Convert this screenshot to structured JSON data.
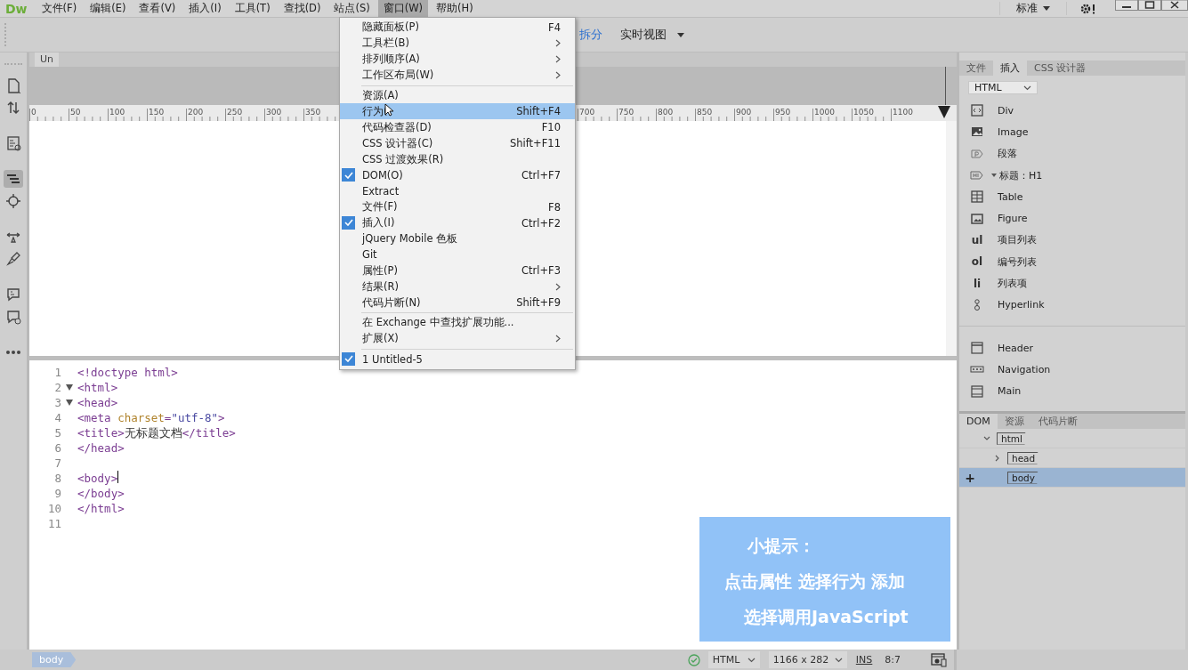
{
  "menubar": {
    "logo": "Dw",
    "menus": [
      {
        "label": "文件(F)",
        "selected": false
      },
      {
        "label": "编辑(E)",
        "selected": false
      },
      {
        "label": "查看(V)",
        "selected": false
      },
      {
        "label": "插入(I)",
        "selected": false
      },
      {
        "label": "工具(T)",
        "selected": false
      },
      {
        "label": "查找(D)",
        "selected": false
      },
      {
        "label": "站点(S)",
        "selected": false
      },
      {
        "label": "窗口(W)",
        "selected": true
      },
      {
        "label": "帮助(H)",
        "selected": false
      }
    ],
    "workspace": "标准"
  },
  "toolbar": {
    "views": [
      {
        "label": "拆分",
        "selected": true
      },
      {
        "label": "实时视图",
        "selected": false
      }
    ]
  },
  "document": {
    "tab": "Un",
    "ruler": {
      "left_labels": [
        "0",
        "50",
        "100",
        "150",
        "200",
        "250",
        "300",
        "350"
      ],
      "right_labels": [
        "700",
        "750",
        "800",
        "850",
        "900",
        "950",
        "1000",
        "1050",
        "1100"
      ]
    },
    "code_lines": [
      {
        "number": "1",
        "fold": false,
        "cursor": false,
        "tokens": [
          {
            "kind": "tag",
            "text": "<!doctype html>"
          }
        ]
      },
      {
        "number": "2",
        "fold": true,
        "cursor": false,
        "tokens": [
          {
            "kind": "tag",
            "text": "<html>"
          }
        ]
      },
      {
        "number": "3",
        "fold": true,
        "cursor": false,
        "tokens": [
          {
            "kind": "tag",
            "text": "<head>"
          }
        ]
      },
      {
        "number": "4",
        "fold": false,
        "cursor": false,
        "tokens": [
          {
            "kind": "tag",
            "text": "<meta "
          },
          {
            "kind": "attr",
            "text": "charset"
          },
          {
            "kind": "tag",
            "text": "="
          },
          {
            "kind": "string",
            "text": "\"utf-8\""
          },
          {
            "kind": "tag",
            "text": ">"
          }
        ]
      },
      {
        "number": "5",
        "fold": false,
        "cursor": false,
        "tokens": [
          {
            "kind": "tag",
            "text": "<title>"
          },
          {
            "kind": "text",
            "text": "无标题文档"
          },
          {
            "kind": "tag",
            "text": "</title>"
          }
        ]
      },
      {
        "number": "6",
        "fold": false,
        "cursor": false,
        "tokens": [
          {
            "kind": "tag",
            "text": "</head>"
          }
        ]
      },
      {
        "number": "7",
        "fold": false,
        "cursor": false
      },
      {
        "number": "8",
        "fold": false,
        "cursor": true,
        "tokens": [
          {
            "kind": "tag",
            "text": "<body>"
          }
        ]
      },
      {
        "number": "9",
        "fold": false,
        "cursor": false,
        "tokens": [
          {
            "kind": "tag",
            "text": "</body>"
          }
        ]
      },
      {
        "number": "10",
        "fold": false,
        "cursor": false,
        "tokens": [
          {
            "kind": "tag",
            "text": "</html>"
          }
        ]
      },
      {
        "number": "11",
        "fold": false,
        "cursor": false
      }
    ]
  },
  "window_menu": {
    "items": [
      {
        "kind": "item",
        "label": "隐藏面板(P)",
        "shortcut": "F4",
        "submenu": false,
        "checked": false,
        "selected": false
      },
      {
        "kind": "item",
        "label": "工具栏(B)",
        "submenu": true,
        "checked": false,
        "selected": false
      },
      {
        "kind": "item",
        "label": "排列顺序(A)",
        "submenu": true,
        "checked": false,
        "selected": false
      },
      {
        "kind": "item",
        "label": "工作区布局(W)",
        "submenu": true,
        "checked": false,
        "selected": false
      },
      {
        "kind": "separator"
      },
      {
        "kind": "item",
        "label": "资源(A)",
        "submenu": false,
        "checked": false,
        "selected": false
      },
      {
        "kind": "item",
        "label": "行为(",
        "shortcut": "Shift+F4",
        "submenu": false,
        "checked": false,
        "selected": true
      },
      {
        "kind": "item",
        "label": "代码检查器(D)",
        "shortcut": "F10",
        "submenu": false,
        "checked": false,
        "selected": false
      },
      {
        "kind": "item",
        "label": "CSS 设计器(C)",
        "shortcut": "Shift+F11",
        "submenu": false,
        "checked": false,
        "selected": false
      },
      {
        "kind": "item",
        "label": "CSS 过渡效果(R)",
        "submenu": false,
        "checked": false,
        "selected": false
      },
      {
        "kind": "item",
        "label": "DOM(O)",
        "shortcut": "Ctrl+F7",
        "submenu": false,
        "checked": true,
        "selected": false
      },
      {
        "kind": "item",
        "label": "Extract",
        "submenu": false,
        "checked": false,
        "selected": false
      },
      {
        "kind": "item",
        "label": "文件(F)",
        "shortcut": "F8",
        "submenu": false,
        "checked": false,
        "selected": false
      },
      {
        "kind": "item",
        "label": "插入(I)",
        "shortcut": "Ctrl+F2",
        "submenu": false,
        "checked": true,
        "selected": false
      },
      {
        "kind": "item",
        "label": "jQuery Mobile 色板",
        "submenu": false,
        "checked": false,
        "selected": false
      },
      {
        "kind": "item",
        "label": "Git",
        "submenu": false,
        "checked": false,
        "selected": false
      },
      {
        "kind": "item",
        "label": "属性(P)",
        "shortcut": "Ctrl+F3",
        "submenu": false,
        "checked": false,
        "selected": false
      },
      {
        "kind": "item",
        "label": "结果(R)",
        "submenu": true,
        "checked": false,
        "selected": false
      },
      {
        "kind": "item",
        "label": "代码片断(N)",
        "shortcut": "Shift+F9",
        "submenu": false,
        "checked": false,
        "selected": false
      },
      {
        "kind": "separator"
      },
      {
        "kind": "item",
        "label": "在 Exchange 中查找扩展功能...",
        "submenu": false,
        "checked": false,
        "selected": false
      },
      {
        "kind": "item",
        "label": "扩展(X)",
        "submenu": true,
        "checked": false,
        "selected": false
      },
      {
        "kind": "separator"
      },
      {
        "kind": "item",
        "label": "1 Untitled-5",
        "submenu": false,
        "checked": true,
        "selected": false
      }
    ]
  },
  "insert_panel": {
    "tabs": [
      {
        "label": "文件",
        "selected": false
      },
      {
        "label": "插入",
        "selected": true
      },
      {
        "label": "CSS 设计器",
        "selected": false
      }
    ],
    "category": "HTML",
    "items": [
      {
        "kind": "item",
        "label": "Div",
        "expandable": false
      },
      {
        "kind": "item",
        "label": "Image",
        "expandable": false
      },
      {
        "kind": "item",
        "label": "段落",
        "expandable": false
      },
      {
        "kind": "item",
        "label": "标题：H1",
        "expandable": true
      },
      {
        "kind": "item",
        "label": "Table",
        "expandable": false
      },
      {
        "kind": "item",
        "label": "Figure",
        "expandable": false
      },
      {
        "kind": "text_icon",
        "icon_text": "ul",
        "label": "项目列表",
        "expandable": false
      },
      {
        "kind": "text_icon",
        "icon_text": "ol",
        "label": "编号列表",
        "expandable": false
      },
      {
        "kind": "text_icon",
        "icon_text": "li",
        "label": "列表项",
        "expandable": false
      },
      {
        "kind": "item",
        "label": "Hyperlink",
        "expandable": false
      },
      {
        "kind": "separator"
      },
      {
        "kind": "item",
        "label": "Header",
        "expandable": false
      },
      {
        "kind": "item",
        "label": "Navigation",
        "expandable": false
      },
      {
        "kind": "item",
        "label": "Main",
        "expandable": false
      }
    ]
  },
  "dom_panel": {
    "tabs": [
      {
        "label": "DOM",
        "selected": true
      },
      {
        "label": "资源",
        "selected": false
      },
      {
        "label": "代码片断",
        "selected": false
      }
    ],
    "add_button": "+",
    "tree": [
      {
        "tag": "html",
        "expanded": true,
        "selected": false,
        "children": [
          {
            "tag": "head",
            "expanded": false,
            "selected": false
          },
          {
            "tag": "body",
            "selected": true
          }
        ]
      }
    ]
  },
  "status_bar": {
    "tag": "body",
    "mode": "HTML",
    "size": "1166 x 282",
    "insert_mode": "INS",
    "position": "8:7"
  },
  "tip": {
    "title": "小提示：",
    "lines": [
      "点击属性 选择行为 添加",
      "选择调用JavaScript"
    ]
  }
}
